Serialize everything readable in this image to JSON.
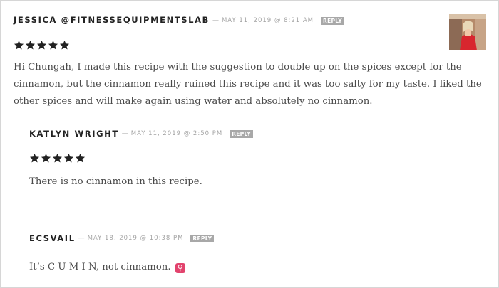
{
  "comments": [
    {
      "author": "Jessica @FitnessEquipmentsLab",
      "dash": "—",
      "date": "May 11, 2019 @ 8:21 am",
      "reply_label": "Reply",
      "rating": 5,
      "text": "Hi Chungah, I made this recipe with the suggestion to double up on the spices except for the cinnamon, but the cinnamon really ruined this recipe and it was too salty for my taste. I liked the other spices and will make again using water and absolutely no cinnamon.",
      "has_avatar": true
    },
    {
      "author": "Katlyn Wright",
      "dash": "—",
      "date": "May 11, 2019 @ 2:50 pm",
      "reply_label": "Reply",
      "rating": 5,
      "text": "There is no cinnamon in this recipe."
    },
    {
      "author": "ecsvail",
      "dash": "—",
      "date": "May 18, 2019 @ 10:38 pm",
      "reply_label": "Reply",
      "text": "It’s C U M I N, not cinnamon.",
      "emoji": "♀"
    }
  ],
  "colors": {
    "author": "#222222",
    "meta": "#a3a3a3",
    "reply_bg": "#a8a8a8",
    "body_text": "#4a4a4a",
    "emoji_bg": "#e2436d"
  },
  "icons": {
    "star": "star-icon",
    "emoji": "female-sign-icon"
  }
}
